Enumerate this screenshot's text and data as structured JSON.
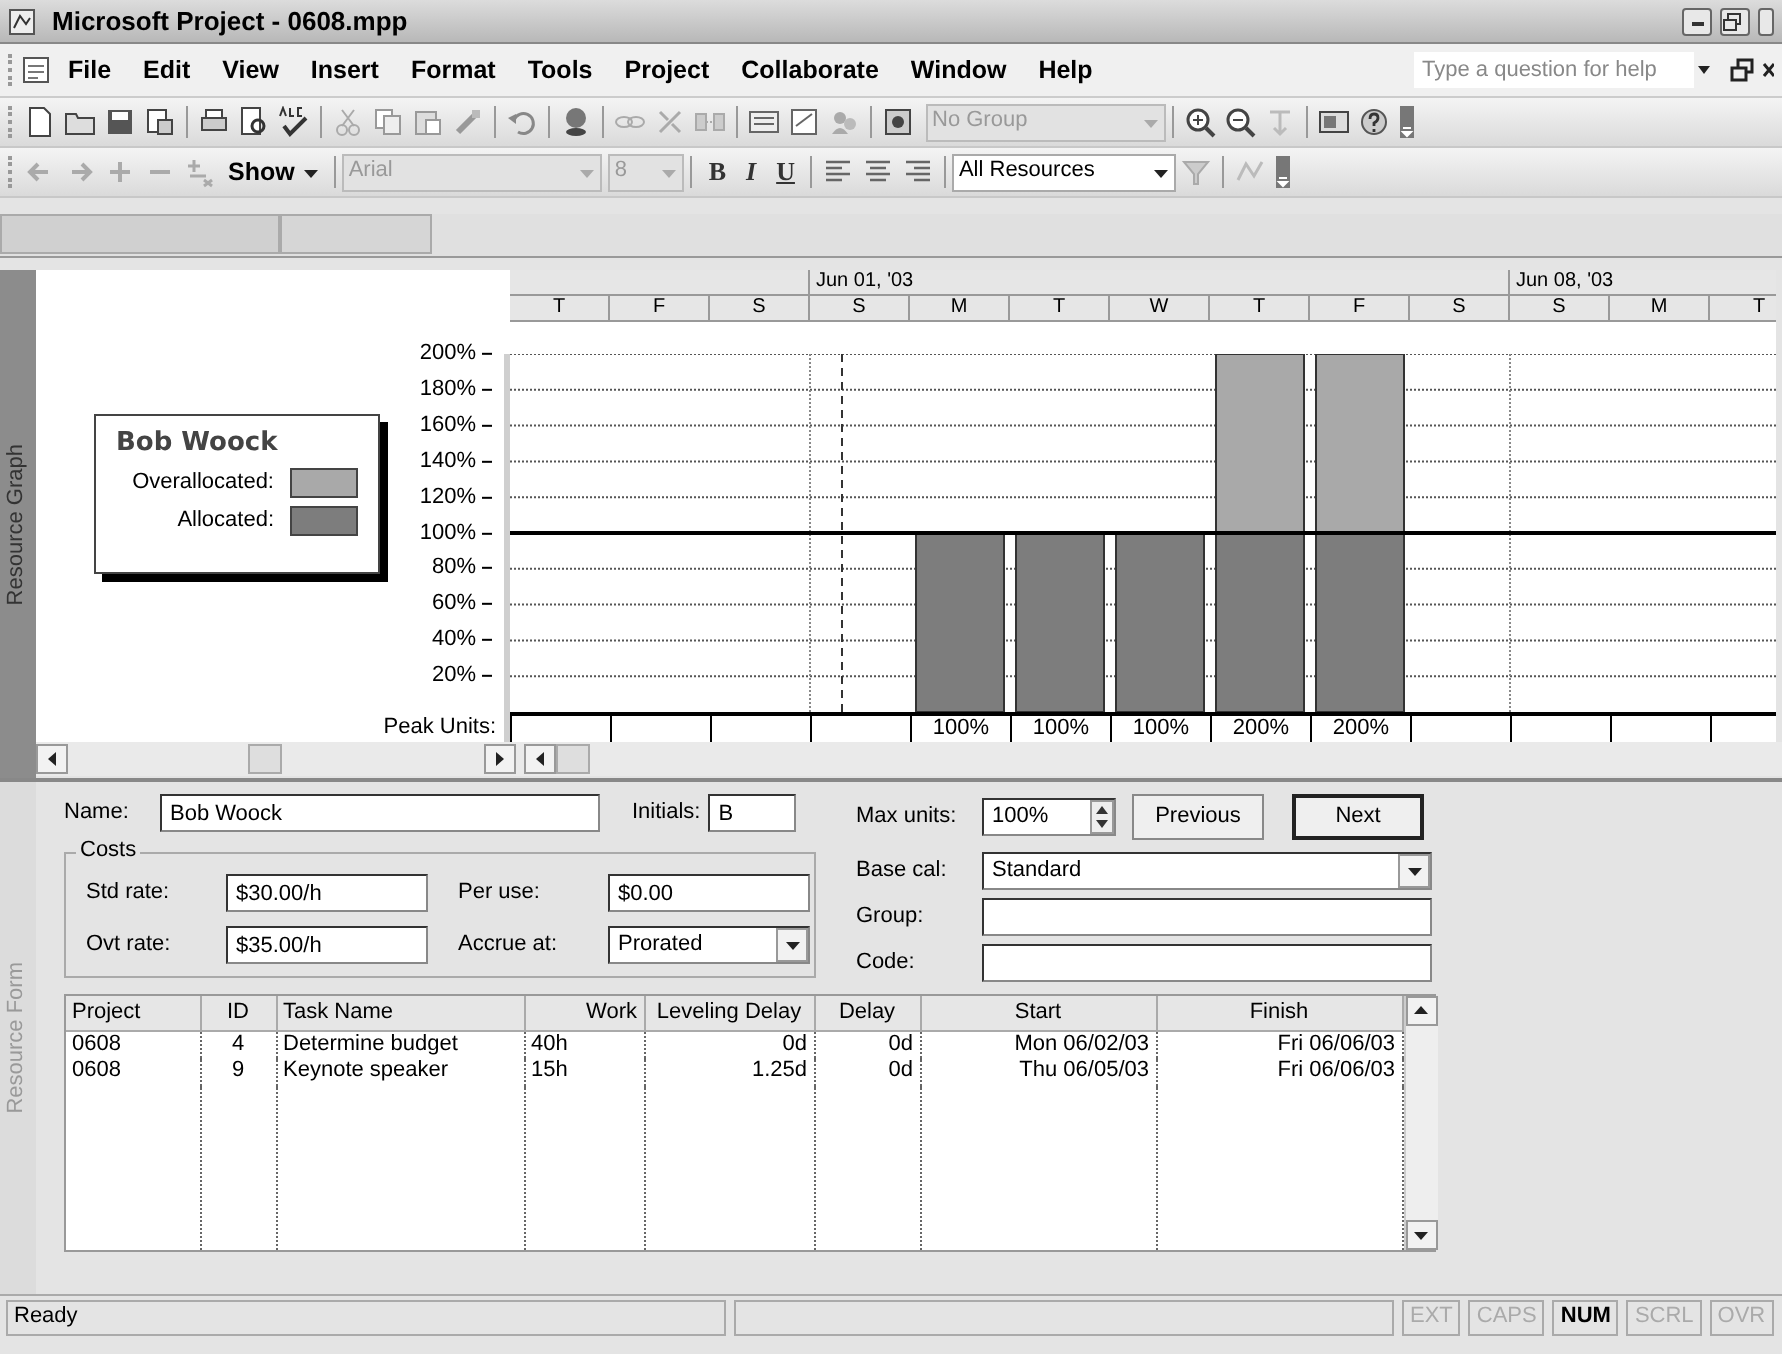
{
  "window": {
    "title": "Microsoft Project - 0608.mpp"
  },
  "menu": {
    "items": [
      "File",
      "Edit",
      "View",
      "Insert",
      "Format",
      "Tools",
      "Project",
      "Collaborate",
      "Window",
      "Help"
    ],
    "help_box": {
      "placeholder": "Type a question for help"
    }
  },
  "toolbar_standard": {
    "group_dropdown": {
      "value": "No Group",
      "disabled": true
    }
  },
  "toolbar_formatting": {
    "show_button": "Show",
    "font": {
      "value": "Arial",
      "disabled": true
    },
    "size": {
      "value": "8",
      "disabled": true
    },
    "bold": "B",
    "italic": "I",
    "underline": "U",
    "filter": {
      "value": "All Resources",
      "disabled": false
    }
  },
  "resource_graph": {
    "pane_label": "Resource Graph",
    "legend": {
      "title": "Bob Woock"
    },
    "timescale": [
      {
        "days": [
          "T",
          "F",
          "S"
        ]
      },
      {
        "label": "Jun 01, '03",
        "days": [
          "S",
          "M",
          "T",
          "W",
          "T",
          "F",
          "S"
        ]
      },
      {
        "label": "Jun 08, '03",
        "days": [
          "S",
          "M",
          "T"
        ]
      }
    ],
    "chart_data": {
      "type": "bar",
      "stacked": true,
      "grid": true,
      "legend": "left",
      "ylim": [
        0,
        200
      ],
      "ref_lines": [
        {
          "axis": "y",
          "value": 100
        }
      ],
      "yticks": [
        {
          "value": 20,
          "label": "20%"
        },
        {
          "value": 40,
          "label": "40%"
        },
        {
          "value": 60,
          "label": "60%"
        },
        {
          "value": 80,
          "label": "80%"
        },
        {
          "value": 100,
          "label": "100%"
        },
        {
          "value": 120,
          "label": "120%"
        },
        {
          "value": 140,
          "label": "140%"
        },
        {
          "value": 160,
          "label": "160%"
        },
        {
          "value": 180,
          "label": "180%"
        },
        {
          "value": 200,
          "label": "200%"
        }
      ],
      "series": [
        {
          "name": "Allocated:",
          "color": "#7d7d7d",
          "values": [
            null,
            null,
            null,
            null,
            100,
            100,
            100,
            100,
            100,
            null,
            null,
            null,
            null
          ]
        },
        {
          "name": "Overallocated:",
          "color": "#a9a9a9",
          "values": [
            null,
            null,
            null,
            null,
            null,
            null,
            null,
            100,
            100,
            null,
            null,
            null,
            null
          ]
        }
      ]
    },
    "peak_units": {
      "label": "Peak Units:",
      "cells": [
        null,
        null,
        null,
        null,
        "100%",
        "100%",
        "100%",
        "200%",
        "200%",
        null,
        null,
        null,
        null
      ]
    }
  },
  "resource_form": {
    "pane_label": "Resource Form",
    "name": {
      "label": "Name:",
      "value": "Bob Woock"
    },
    "initials": {
      "label": "Initials:",
      "value": "B"
    },
    "max_units": {
      "label": "Max units:",
      "value": "100%"
    },
    "buttons": [
      {
        "label": "Previous",
        "default": false
      },
      {
        "label": "Next",
        "default": true
      }
    ],
    "costs": {
      "title": "Costs",
      "fields": [
        {
          "label": "Std rate:",
          "value": "$30.00/h",
          "kind": "text"
        },
        {
          "label": "Per use:",
          "value": "$0.00",
          "kind": "text"
        },
        {
          "label": "Ovt rate:",
          "value": "$35.00/h",
          "kind": "text"
        },
        {
          "label": "Accrue at:",
          "value": "Prorated",
          "kind": "dropdown"
        }
      ]
    },
    "base_cal": {
      "label": "Base cal:",
      "value": "Standard"
    },
    "group": {
      "label": "Group:"
    },
    "code": {
      "label": "Code:"
    },
    "table": {
      "columns": [
        {
          "label": "Project",
          "kind": "text"
        },
        {
          "label": "ID",
          "kind": "id"
        },
        {
          "label": "Task Name",
          "kind": "text"
        },
        {
          "label": "Work",
          "kind": "text"
        },
        {
          "label": "Leveling Delay",
          "kind": "number"
        },
        {
          "label": "Delay",
          "kind": "number"
        },
        {
          "label": "Start",
          "kind": "number"
        },
        {
          "label": "Finish",
          "kind": "number"
        }
      ],
      "rows": [
        [
          "0608",
          "4",
          "Determine budget",
          "40h",
          "0d",
          "0d",
          "Mon 06/02/03",
          "Fri 06/06/03"
        ],
        [
          "0608",
          "9",
          "Keynote speaker",
          "15h",
          "1.25d",
          "0d",
          "Thu 06/05/03",
          "Fri 06/06/03"
        ]
      ]
    }
  },
  "status_bar": {
    "message": "Ready",
    "indicators": [
      {
        "label": "EXT",
        "on": false
      },
      {
        "label": "CAPS",
        "on": false
      },
      {
        "label": "NUM",
        "on": true
      },
      {
        "label": "SCRL",
        "on": false
      },
      {
        "label": "OVR",
        "on": false
      }
    ]
  }
}
